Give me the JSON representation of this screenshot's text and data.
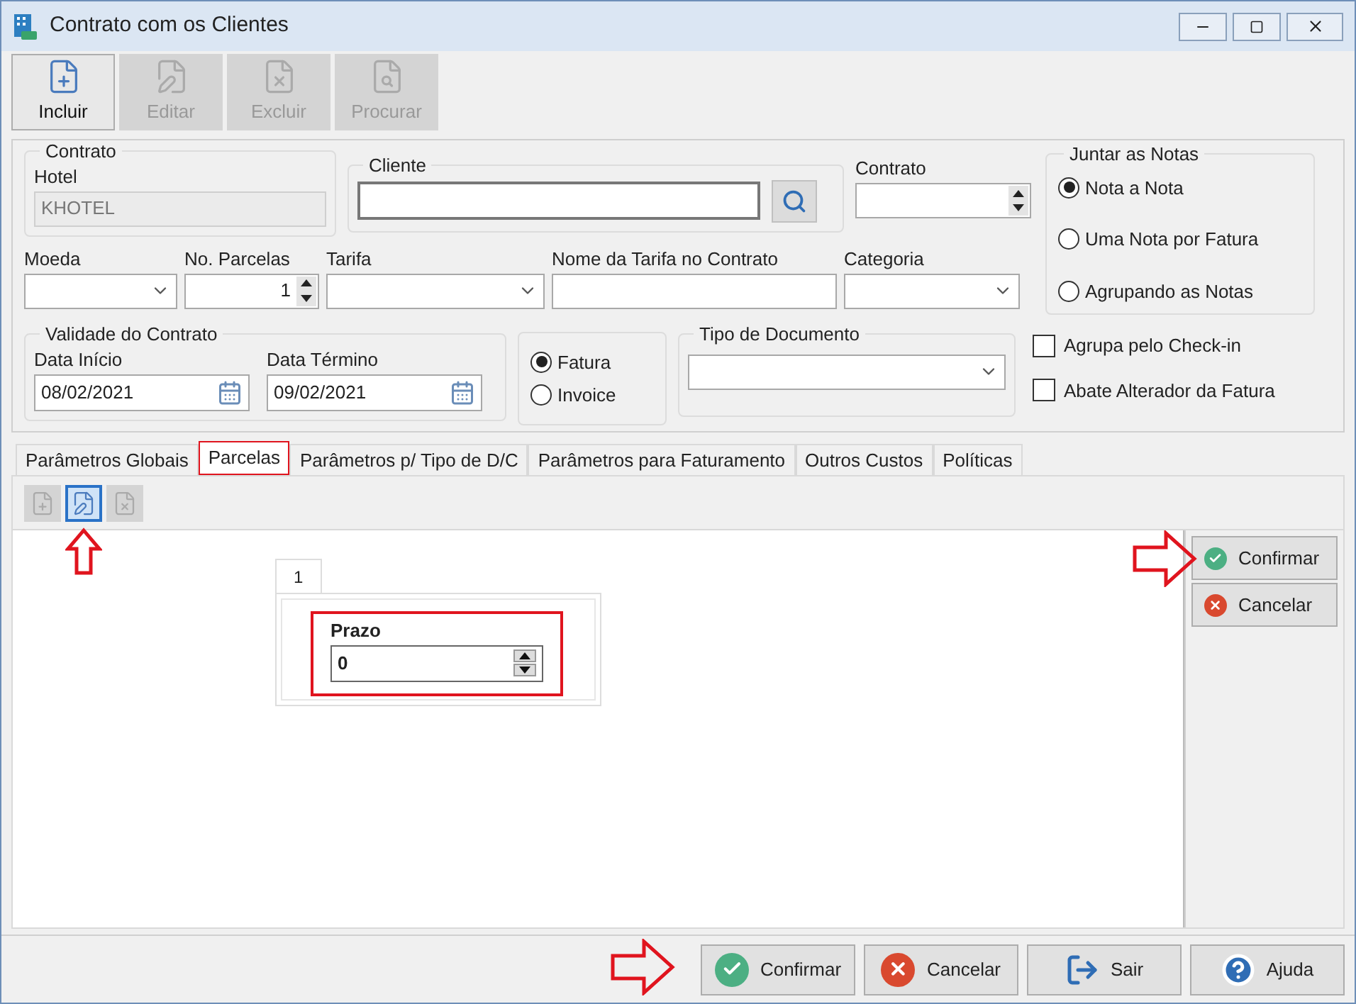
{
  "window": {
    "title": "Contrato com os Clientes"
  },
  "toolbar": [
    {
      "kind": "add",
      "label": "Incluir",
      "disabled": false
    },
    {
      "kind": "edit",
      "label": "Editar",
      "disabled": true
    },
    {
      "kind": "delete",
      "label": "Excluir",
      "disabled": true
    },
    {
      "kind": "search",
      "label": "Procurar",
      "disabled": true
    }
  ],
  "form": {
    "contrato_group": {
      "title": "Contrato",
      "hotel_label": "Hotel",
      "hotel_value": "KHOTEL"
    },
    "cliente": {
      "title": "Cliente"
    },
    "contrato_field": {
      "label": "Contrato"
    },
    "fields": [
      {
        "kind": "combo",
        "label": "Moeda"
      },
      {
        "kind": "spinner",
        "label": "No. Parcelas",
        "value": "1"
      },
      {
        "kind": "combo",
        "label": "Tarifa"
      },
      {
        "kind": "text",
        "label": "Nome da Tarifa no Contrato"
      },
      {
        "kind": "combo",
        "label": "Categoria"
      }
    ],
    "juntar": {
      "title": "Juntar as Notas",
      "options": [
        {
          "label": "Nota a Nota",
          "selected": true
        },
        {
          "label": "Uma Nota por Fatura",
          "selected": false
        },
        {
          "label": "Agrupando as Notas",
          "selected": false
        }
      ]
    },
    "validade": {
      "title": "Validade do Contrato",
      "dates": [
        {
          "label": "Data Início",
          "value": "08/02/2021"
        },
        {
          "label": "Data Término",
          "value": "09/02/2021"
        }
      ]
    },
    "documento": [
      {
        "label": "Fatura",
        "selected": true
      },
      {
        "label": "Invoice",
        "selected": false
      }
    ],
    "tipo_documento": {
      "title": "Tipo de Documento"
    },
    "checkboxes": [
      {
        "label": "Agrupa pelo Check-in",
        "checked": false
      },
      {
        "label": "Abate Alterador da Fatura",
        "checked": false
      }
    ]
  },
  "tabs": [
    {
      "label": "Parâmetros Globais",
      "selected": false,
      "highlighted": false
    },
    {
      "label": "Parcelas",
      "selected": true,
      "highlighted": true
    },
    {
      "label": "Parâmetros p/ Tipo de D/C",
      "selected": false,
      "highlighted": false
    },
    {
      "label": "Parâmetros para Faturamento",
      "selected": false,
      "highlighted": false
    },
    {
      "label": "Outros Custos",
      "selected": false,
      "highlighted": false
    },
    {
      "label": "Políticas",
      "selected": false,
      "highlighted": false
    }
  ],
  "tab_toolbar": [
    {
      "kind": "add",
      "disabled": true,
      "pointed": false
    },
    {
      "kind": "edit",
      "disabled": false,
      "pointed": true
    },
    {
      "kind": "delete",
      "disabled": true,
      "pointed": false
    }
  ],
  "parcelas": {
    "page_tabs": [
      {
        "label": "1",
        "selected": true
      }
    ],
    "prazo": {
      "label": "Prazo",
      "value": "0",
      "highlighted": true
    }
  },
  "side_buttons": [
    {
      "kind": "confirm",
      "label": "Confirmar",
      "pointed": true
    },
    {
      "kind": "cancel",
      "label": "Cancelar",
      "pointed": false
    }
  ],
  "footer_buttons": [
    {
      "kind": "confirm",
      "label": "Confirmar",
      "pointed": true
    },
    {
      "kind": "cancel",
      "label": "Cancelar",
      "pointed": false
    },
    {
      "kind": "exit",
      "label": "Sair",
      "pointed": false
    },
    {
      "kind": "help",
      "label": "Ajuda",
      "pointed": false
    }
  ]
}
